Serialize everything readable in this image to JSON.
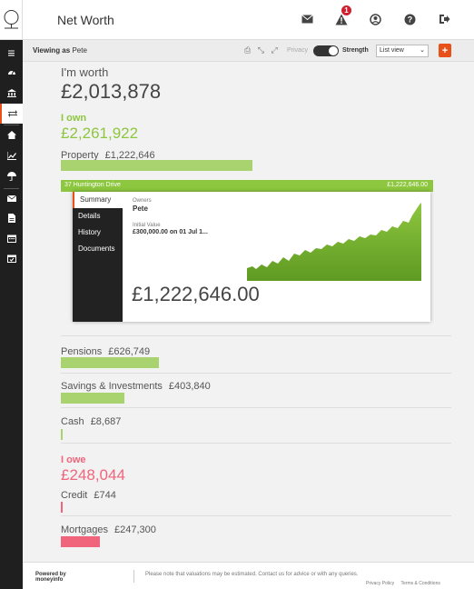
{
  "app": {
    "title": "Net Worth",
    "alert_count": "1"
  },
  "toolbar": {
    "viewing_prefix": "Viewing as",
    "viewing_user": "Pete",
    "privacy_label": "Privacy",
    "strength_label": "Strength",
    "view_select": "List view",
    "add_label": "+"
  },
  "summary": {
    "worth_label": "I'm worth",
    "worth_value": "£2,013,878",
    "own_label": "I own",
    "own_value": "£2,261,922",
    "owe_label": "I owe",
    "owe_value": "£248,044"
  },
  "assets": [
    {
      "label": "Property",
      "value": "£1,222,646",
      "share": 1.0
    },
    {
      "label": "Pensions",
      "value": "£626,749",
      "share": 0.513
    },
    {
      "label": "Savings & Investments",
      "value": "£403,840",
      "share": 0.33
    },
    {
      "label": "Cash",
      "value": "£8,687",
      "share": 0.007
    }
  ],
  "liabilities": [
    {
      "label": "Credit",
      "value": "£744",
      "share": 0.003
    },
    {
      "label": "Mortgages",
      "value": "£247,300",
      "share": 0.2
    }
  ],
  "property_card": {
    "header_name": "37 Huntington Drive",
    "header_amount": "£1,222,646.00",
    "nav": [
      "Summary",
      "Details",
      "History",
      "Documents"
    ],
    "owners_label": "Owners",
    "owners_value": "Pete",
    "initial_label": "Initial Value",
    "initial_value": "£300,000.00 on 01 Jul 1...",
    "amount": "£1,222,646.00"
  },
  "footer": {
    "powered_by": "Powered by",
    "brand": "moneyinfo",
    "note": "Please note that valuations may be estimated. Contact us for advice or with any queries.",
    "privacy": "Privacy Policy",
    "terms": "Terms & Conditions"
  },
  "colors": {
    "accent": "#e8501a",
    "own": "#8dc63f",
    "owe": "#f0657b",
    "sidebar": "#1f1f1f"
  }
}
